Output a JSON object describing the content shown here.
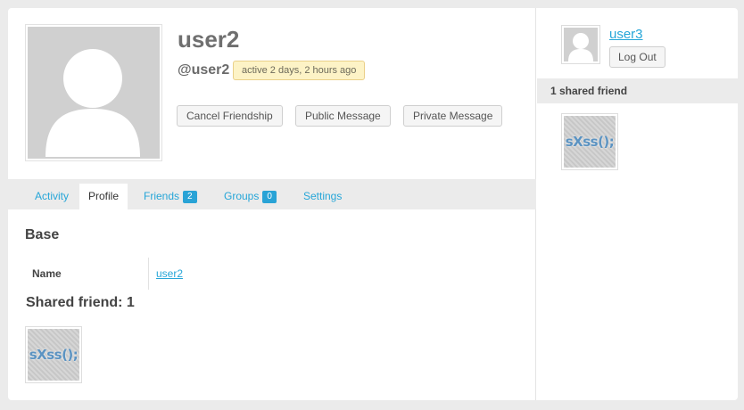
{
  "profile": {
    "display_name": "user2",
    "mention": "@user2",
    "activity": "active 2 days, 2 hours ago",
    "actions": {
      "cancel_friendship": "Cancel Friendship",
      "public_message": "Public Message",
      "private_message": "Private Message"
    }
  },
  "tabs": [
    {
      "label": "Activity"
    },
    {
      "label": "Profile"
    },
    {
      "label": "Friends",
      "count": "2"
    },
    {
      "label": "Groups",
      "count": "0"
    },
    {
      "label": "Settings"
    }
  ],
  "content": {
    "base_heading": "Base",
    "fields": [
      {
        "label": "Name",
        "value": "user2"
      }
    ],
    "shared_heading": "Shared friend: 1",
    "shared_friend_avatar_text": "sXss();"
  },
  "sidebar": {
    "current_user": "user3",
    "logout_label": "Log Out",
    "shared_label": "1 shared friend",
    "shared_friend_avatar_text": "sXss();"
  }
}
